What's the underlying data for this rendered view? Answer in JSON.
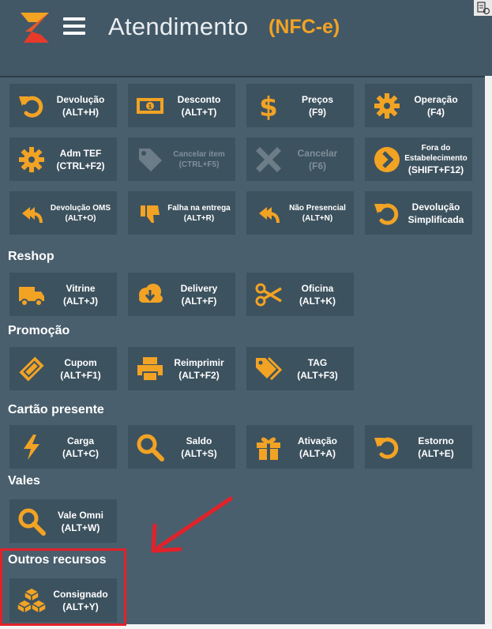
{
  "header": {
    "title": "Atendimento",
    "subtitle": "(NFC-e)"
  },
  "colors": {
    "accent": "#f2a324",
    "header_bg": "#435866",
    "panel_bg": "#4a5f6d",
    "tile_bg": "#3d525f",
    "highlight": "#e2222a"
  },
  "tiles": [
    {
      "name": "devolucao",
      "line1": "Devolução",
      "line2": "(ALT+H)",
      "icon": "undo-icon"
    },
    {
      "name": "desconto",
      "line1": "Desconto",
      "line2": "(ALT+T)",
      "icon": "banknote-icon"
    },
    {
      "name": "precos",
      "line1": "Preços",
      "line2": "(F9)",
      "icon": "dollar-icon"
    },
    {
      "name": "operacao",
      "line1": "Operação",
      "line2": "(F4)",
      "icon": "gear-icon"
    },
    {
      "name": "adm-tef",
      "line1": "Adm TEF",
      "line2": "(CTRL+F2)",
      "icon": "gear-icon"
    },
    {
      "name": "cancelar-item",
      "line1": "Cancelar item",
      "line2": "(CTRL+F5)",
      "icon": "tag-icon"
    },
    {
      "name": "cancelar",
      "line1": "Cancelar",
      "line2": "(F6)",
      "icon": "x-icon"
    },
    {
      "name": "fora-do-estabelecimento",
      "line1": "Fora do",
      "line2": "Estabelecimento",
      "line3": "(SHIFT+F12)",
      "icon": "chevron-right-circle-icon"
    },
    {
      "name": "devolucao-oms",
      "line1": "Devolução OMS",
      "line2": "(ALT+O)",
      "icon": "reply-all-icon"
    },
    {
      "name": "falha-na-entrega",
      "line1": "Falha na entrega",
      "line2": "(ALT+R)",
      "icon": "thumbs-down-icon"
    },
    {
      "name": "nao-presencial",
      "line1": "Não Presencial",
      "line2": "(ALT+N)",
      "icon": "reply-all-icon"
    },
    {
      "name": "devolucao-simplificada",
      "line1": "Devolução",
      "line2": "Simplificada",
      "icon": "undo-icon"
    },
    {
      "name": "vitrine",
      "line1": "Vitrine",
      "line2": "(ALT+J)",
      "icon": "truck-icon"
    },
    {
      "name": "delivery",
      "line1": "Delivery",
      "line2": "(ALT+F)",
      "icon": "cloud-download-icon"
    },
    {
      "name": "oficina",
      "line1": "Oficina",
      "line2": "(ALT+K)",
      "icon": "scissors-icon"
    },
    {
      "name": "cupom",
      "line1": "Cupom",
      "line2": "(ALT+F1)",
      "icon": "ticket-icon"
    },
    {
      "name": "reimprimir",
      "line1": "Reimprimir",
      "line2": "(ALT+F2)",
      "icon": "printer-icon"
    },
    {
      "name": "tag",
      "line1": "TAG",
      "line2": "(ALT+F3)",
      "icon": "tags-icon"
    },
    {
      "name": "carga",
      "line1": "Carga",
      "line2": "(ALT+C)",
      "icon": "bolt-icon"
    },
    {
      "name": "saldo",
      "line1": "Saldo",
      "line2": "(ALT+S)",
      "icon": "search-icon"
    },
    {
      "name": "ativacao",
      "line1": "Ativação",
      "line2": "(ALT+A)",
      "icon": "gift-icon"
    },
    {
      "name": "estorno",
      "line1": "Estorno",
      "line2": "(ALT+E)",
      "icon": "undo-icon"
    },
    {
      "name": "vale-omni",
      "line1": "Vale Omni",
      "line2": "(ALT+W)",
      "icon": "search-icon"
    },
    {
      "name": "consignado",
      "line1": "Consignado",
      "line2": "(ALT+Y)",
      "icon": "cubes-icon"
    }
  ],
  "sections": {
    "reshop": "Reshop",
    "promocao": "Promoção",
    "cartao_presente": "Cartão presente",
    "vales": "Vales",
    "outros_recursos": "Outros recursos"
  }
}
